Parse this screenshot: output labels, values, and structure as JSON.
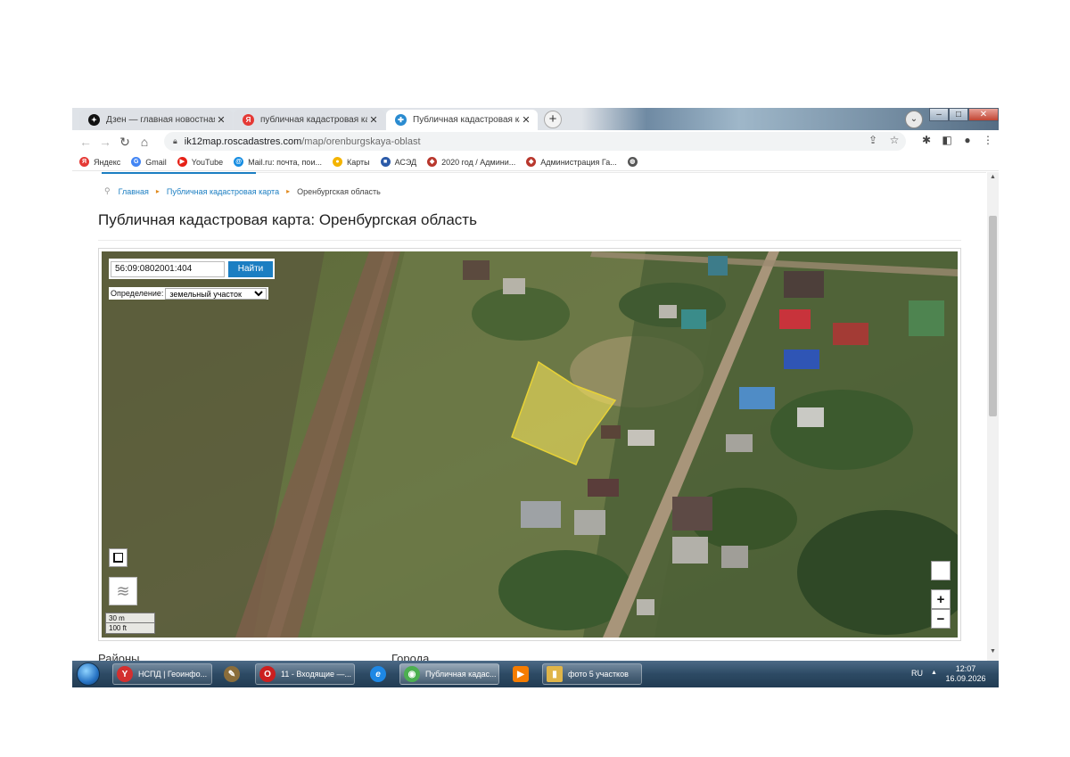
{
  "browser": {
    "tabs": [
      {
        "title": "Дзен — главная новостная инф",
        "favicon": "dzen-icon",
        "active": false
      },
      {
        "title": "публичная кадастровая карта о",
        "favicon": "yandex-icon",
        "active": false
      },
      {
        "title": "Публичная кадастровая карта: (",
        "favicon": "map-site-icon",
        "active": true
      }
    ],
    "new_tab": "+",
    "close": "✕",
    "url_host": "ik12map.roscadastres.com",
    "url_path": "/map/orenburgskaya-oblast"
  },
  "bookmarks": [
    {
      "label": "Яндекс",
      "icon": "yandex-icon",
      "color": "#e53935",
      "glyph": "Я"
    },
    {
      "label": "Gmail",
      "icon": "google-icon",
      "color": "#4285f4",
      "glyph": "G"
    },
    {
      "label": "YouTube",
      "icon": "youtube-icon",
      "color": "#e62117",
      "glyph": "▶"
    },
    {
      "label": "Mail.ru: почта, пои...",
      "icon": "mailru-icon",
      "color": "#168de2",
      "glyph": "@"
    },
    {
      "label": "Карты",
      "icon": "maps-pin-icon",
      "color": "#f4b400",
      "glyph": "●"
    },
    {
      "label": "АСЭД",
      "icon": "ased-icon",
      "color": "#2b5aa8",
      "glyph": "■"
    },
    {
      "label": "2020 год / Админи...",
      "icon": "admin-emblem-icon",
      "color": "#b8372d",
      "glyph": "◆"
    },
    {
      "label": "Администрация Га...",
      "icon": "admin-emblem-icon",
      "color": "#b8372d",
      "glyph": "◆"
    },
    {
      "label": "",
      "icon": "globe-icon",
      "color": "#555555",
      "glyph": "◍"
    }
  ],
  "page": {
    "breadcrumb": [
      "Главная",
      "Публичная кадастровая карта",
      "Оренбургская область"
    ],
    "title": "Публичная кадастровая карта: Оренбургская область",
    "search": {
      "value": "56:09:0802001:404",
      "button": "Найти"
    },
    "definition": {
      "label": "Определение:",
      "selected": "земельный участок"
    },
    "scale": [
      "30 m",
      "100 ft"
    ],
    "zoom_in": "+",
    "zoom_out": "−",
    "below_left": "Районы",
    "below_right": "Города"
  },
  "taskbar": {
    "items": [
      {
        "label": "НСПД | Геоинфо...",
        "icon": "yandex-browser-icon",
        "color": "#d32f2f",
        "glyph": "Y"
      },
      {
        "label": "",
        "icon": "app-icon",
        "color": "#8a6d3b",
        "glyph": "✎"
      },
      {
        "label": "11 - Входящие —...",
        "icon": "opera-icon",
        "color": "#cc1f1f",
        "glyph": "O"
      },
      {
        "label": "",
        "icon": "internet-explorer-icon",
        "color": "#1e88e5",
        "glyph": "e"
      },
      {
        "label": "Публичная кадас...",
        "icon": "chrome-icon",
        "color": "#4caf50",
        "glyph": "◉"
      },
      {
        "label": "",
        "icon": "media-player-icon",
        "color": "#f57c00",
        "glyph": "▶"
      },
      {
        "label": "фото 5 участков",
        "icon": "folder-icon",
        "color": "#e0b548",
        "glyph": "▮"
      }
    ],
    "lang": "RU",
    "time": "12:07",
    "date": "16.09.2026"
  },
  "colors": {
    "accent": "#1b7ec2",
    "parcel": "#f2e05a"
  }
}
